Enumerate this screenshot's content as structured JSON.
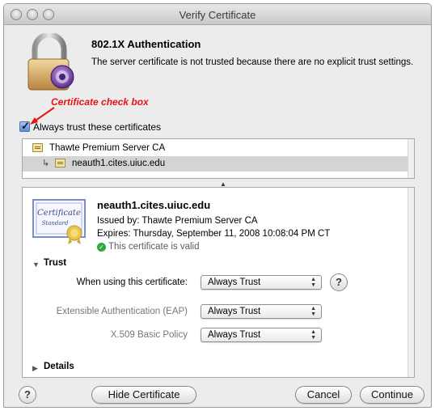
{
  "window": {
    "title": "Verify Certificate"
  },
  "header": {
    "title": "802.1X Authentication",
    "message": "The server certificate is not trusted because there are no explicit trust settings."
  },
  "annotation": {
    "text": "Certificate check box",
    "color": "#e81414"
  },
  "always_trust": {
    "label": "Always trust these certificates",
    "checked": true
  },
  "tree": {
    "items": [
      {
        "label": "Thawte Premium Server CA",
        "icon": "certificate-icon",
        "selected": false
      },
      {
        "label": "neauth1.cites.uiuc.edu",
        "icon": "certificate-icon",
        "selected": true
      }
    ]
  },
  "certificate": {
    "name": "neauth1.cites.uiuc.edu",
    "issued_by": "Issued by: Thawte Premium Server CA",
    "expires": "Expires: Thursday, September 11, 2008 10:08:04 PM CT",
    "status": "This certificate is valid",
    "status_color": "#2eaa3b",
    "image_script": "Certificate",
    "image_subtext": "Standard"
  },
  "trust": {
    "label": "Trust",
    "when_using_label": "When using this certificate:",
    "when_using_value": "Always Trust",
    "eap_label": "Extensible Authentication (EAP)",
    "eap_value": "Always Trust",
    "x509_label": "X.509 Basic Policy",
    "x509_value": "Always Trust"
  },
  "details": {
    "label": "Details"
  },
  "buttons": {
    "help": "?",
    "hide_certificate": "Hide Certificate",
    "cancel": "Cancel",
    "continue": "Continue"
  }
}
